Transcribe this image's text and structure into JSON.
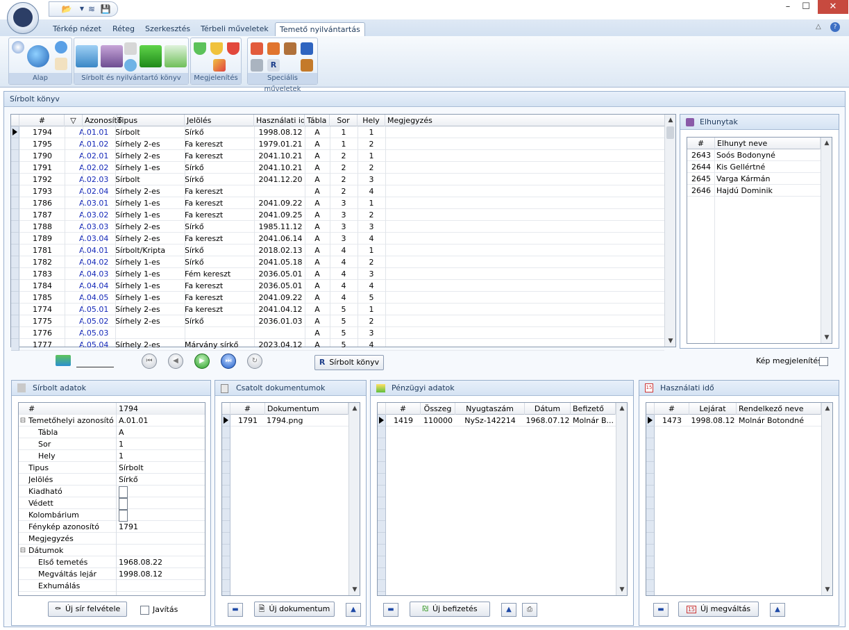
{
  "ribbon": {
    "tabs": [
      "Térkép nézet",
      "Réteg",
      "Szerkesztés",
      "Térbeli műveletek",
      "Temető nyilvántartás"
    ],
    "active_tab": "Temető nyilvántartás",
    "groups": [
      "Alap",
      "Sírbolt és nyilvántartó könyv",
      "Megjelenítés",
      "Speciális műveletek"
    ]
  },
  "main": {
    "title": "Sírbolt könyv",
    "grid": {
      "columns": [
        "#",
        "Azonosító",
        "Tipus",
        "Jelölés",
        "Használati idő",
        "Tábla",
        "Sor",
        "Hely",
        "Megjegyzés"
      ],
      "rows": [
        {
          "id": "1794",
          "azon": "A.01.01",
          "tipus": "Sírbolt",
          "jeloles": "Sírkő",
          "ido": "1998.08.12",
          "tabla": "A",
          "sor": "1",
          "hely": "1"
        },
        {
          "id": "1795",
          "azon": "A.01.02",
          "tipus": "Sírhely 2-es",
          "jeloles": "Fa kereszt",
          "ido": "1979.01.21",
          "tabla": "A",
          "sor": "1",
          "hely": "2"
        },
        {
          "id": "1790",
          "azon": "A.02.01",
          "tipus": "Sírhely 2-es",
          "jeloles": "Fa kereszt",
          "ido": "2041.10.21",
          "tabla": "A",
          "sor": "2",
          "hely": "1"
        },
        {
          "id": "1791",
          "azon": "A.02.02",
          "tipus": "Sírhely 1-es",
          "jeloles": "Sírkő",
          "ido": "2041.10.21",
          "tabla": "A",
          "sor": "2",
          "hely": "2"
        },
        {
          "id": "1792",
          "azon": "A.02.03",
          "tipus": "Sírbolt",
          "jeloles": "Sírkő",
          "ido": "2041.12.20",
          "tabla": "A",
          "sor": "2",
          "hely": "3"
        },
        {
          "id": "1793",
          "azon": "A.02.04",
          "tipus": "Sírhely 2-es",
          "jeloles": "Fa kereszt",
          "ido": "",
          "tabla": "A",
          "sor": "2",
          "hely": "4"
        },
        {
          "id": "1786",
          "azon": "A.03.01",
          "tipus": "Sírhely 1-es",
          "jeloles": "Fa kereszt",
          "ido": "2041.09.22",
          "tabla": "A",
          "sor": "3",
          "hely": "1"
        },
        {
          "id": "1787",
          "azon": "A.03.02",
          "tipus": "Sírhely 1-es",
          "jeloles": "Fa kereszt",
          "ido": "2041.09.25",
          "tabla": "A",
          "sor": "3",
          "hely": "2"
        },
        {
          "id": "1788",
          "azon": "A.03.03",
          "tipus": "Sírhely 2-es",
          "jeloles": "Sírkő",
          "ido": "1985.11.12",
          "tabla": "A",
          "sor": "3",
          "hely": "3"
        },
        {
          "id": "1789",
          "azon": "A.03.04",
          "tipus": "Sírhely 2-es",
          "jeloles": "Fa kereszt",
          "ido": "2041.06.14",
          "tabla": "A",
          "sor": "3",
          "hely": "4"
        },
        {
          "id": "1781",
          "azon": "A.04.01",
          "tipus": "Sírbolt/Kripta",
          "jeloles": "Sírkő",
          "ido": "2018.02.13",
          "tabla": "A",
          "sor": "4",
          "hely": "1"
        },
        {
          "id": "1782",
          "azon": "A.04.02",
          "tipus": "Sírhely 1-es",
          "jeloles": "Sírkő",
          "ido": "2041.05.18",
          "tabla": "A",
          "sor": "4",
          "hely": "2"
        },
        {
          "id": "1783",
          "azon": "A.04.03",
          "tipus": "Sírhely 1-es",
          "jeloles": "Fém kereszt",
          "ido": "2036.05.01",
          "tabla": "A",
          "sor": "4",
          "hely": "3"
        },
        {
          "id": "1784",
          "azon": "A.04.04",
          "tipus": "Sírhely 1-es",
          "jeloles": "Fa kereszt",
          "ido": "2036.05.01",
          "tabla": "A",
          "sor": "4",
          "hely": "4"
        },
        {
          "id": "1785",
          "azon": "A.04.05",
          "tipus": "Sírhely 1-es",
          "jeloles": "Fa kereszt",
          "ido": "2041.09.22",
          "tabla": "A",
          "sor": "4",
          "hely": "5"
        },
        {
          "id": "1774",
          "azon": "A.05.01",
          "tipus": "Sírhely 2-es",
          "jeloles": "Fa kereszt",
          "ido": "2041.04.12",
          "tabla": "A",
          "sor": "5",
          "hely": "1"
        },
        {
          "id": "1775",
          "azon": "A.05.02",
          "tipus": "Sírhely 2-es",
          "jeloles": "Sírkő",
          "ido": "2036.01.03",
          "tabla": "A",
          "sor": "5",
          "hely": "2"
        },
        {
          "id": "1776",
          "azon": "A.05.03",
          "tipus": "",
          "jeloles": "",
          "ido": "",
          "tabla": "A",
          "sor": "5",
          "hely": "3"
        },
        {
          "id": "1777",
          "azon": "A.05.04",
          "tipus": "Sírhely 2-es",
          "jeloles": "Márvány sírkő",
          "ido": "2023.04.12",
          "tabla": "A",
          "sor": "5",
          "hely": "4"
        }
      ]
    },
    "sirbolt_konyv_button": "Sírbolt könyv",
    "kep_megjelenitese": "Kép megjelenítése"
  },
  "elhunytak": {
    "title": "Elhunytak",
    "columns": [
      "#",
      "Elhunyt neve"
    ],
    "rows": [
      {
        "id": "2643",
        "name": "Soós Bodonyné"
      },
      {
        "id": "2644",
        "name": "Kis Gellértné"
      },
      {
        "id": "2645",
        "name": "Varga Kármán"
      },
      {
        "id": "2646",
        "name": "Hajdú Dominik"
      }
    ]
  },
  "sirbolt_adatok": {
    "title": "Sírbolt adatok",
    "props": [
      {
        "label": "#",
        "value": "1794",
        "indent": 0,
        "type": "text"
      },
      {
        "label": "Temetőhelyi azonosító",
        "value": "A.01.01",
        "indent": 0,
        "type": "text",
        "expand": "⊟"
      },
      {
        "label": "Tábla",
        "value": "A",
        "indent": 1,
        "type": "text"
      },
      {
        "label": "Sor",
        "value": "1",
        "indent": 1,
        "type": "text"
      },
      {
        "label": "Hely",
        "value": "1",
        "indent": 1,
        "type": "text"
      },
      {
        "label": "Tipus",
        "value": "Sírbolt",
        "indent": 0,
        "type": "text"
      },
      {
        "label": "Jelölés",
        "value": "Sírkő",
        "indent": 0,
        "type": "text"
      },
      {
        "label": "Kiadható",
        "value": "",
        "indent": 0,
        "type": "check"
      },
      {
        "label": "Védett",
        "value": "",
        "indent": 0,
        "type": "check"
      },
      {
        "label": "Kolombárium",
        "value": "",
        "indent": 0,
        "type": "check"
      },
      {
        "label": "Fénykép azonosító",
        "value": "1791",
        "indent": 0,
        "type": "text"
      },
      {
        "label": "Megjegyzés",
        "value": "",
        "indent": 0,
        "type": "text"
      },
      {
        "label": "Dátumok",
        "value": "",
        "indent": 0,
        "type": "text",
        "expand": "⊟"
      },
      {
        "label": "Első temetés",
        "value": "1968.08.22",
        "indent": 1,
        "type": "text"
      },
      {
        "label": "Megváltás lejár",
        "value": "1998.08.12",
        "indent": 1,
        "type": "text"
      },
      {
        "label": "Exhumálás",
        "value": "",
        "indent": 1,
        "type": "text"
      }
    ],
    "new_button": "Új sír felvétele",
    "javitas": "Javítás"
  },
  "csatolt": {
    "title": "Csatolt dokumentumok",
    "columns": [
      "#",
      "Dokumentum"
    ],
    "rows": [
      {
        "id": "1791",
        "doc": "1794.png"
      }
    ],
    "new_button": "Új dokumentum"
  },
  "penzugyi": {
    "title": "Pénzügyi adatok",
    "columns": [
      "#",
      "Összeg",
      "Nyugtaszám",
      "Dátum",
      "Befizető"
    ],
    "rows": [
      {
        "id": "1419",
        "osszeg": "110000",
        "nyugta": "NySz-142214",
        "datum": "1968.07.12",
        "befizeto": "Molnár B..."
      }
    ],
    "new_button": "Új befizetés"
  },
  "hasznalati": {
    "title": "Használati idő",
    "columns": [
      "#",
      "Lejárat",
      "Rendelkező neve"
    ],
    "rows": [
      {
        "id": "1473",
        "lejarat": "1998.08.12",
        "nev": "Molnár Botondné"
      }
    ],
    "new_button": "Új megváltás"
  },
  "colors": {
    "accent": "#1428b8",
    "panel_border": "#98aecb",
    "header_bg": "#d5e3f3",
    "close": "#c74a3f"
  }
}
